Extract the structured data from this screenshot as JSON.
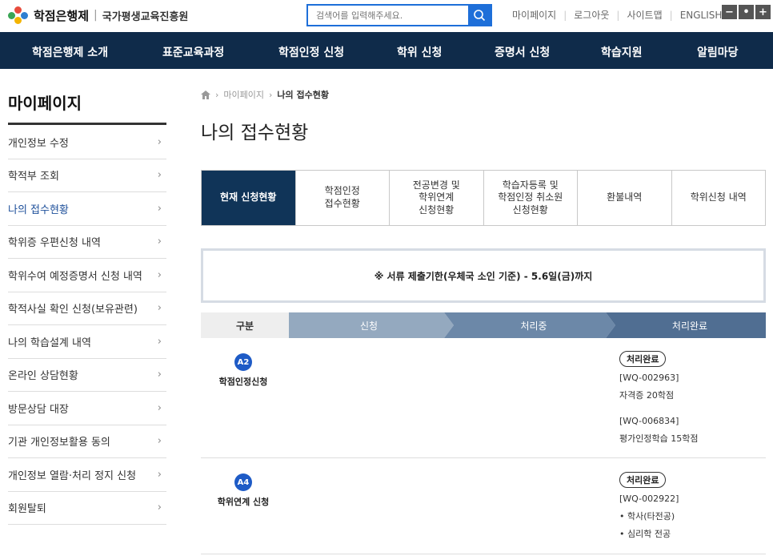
{
  "header": {
    "logo_title": "학점은행제",
    "logo_sub": "국가평생교육진흥원",
    "search_placeholder": "검색어를 입력해주세요.",
    "util_links": [
      "마이페이지",
      "로그아웃",
      "사이트맵",
      "ENGLISH"
    ],
    "zoom": [
      "−",
      "•",
      "+"
    ]
  },
  "gnb": [
    "학점은행제 소개",
    "표준교육과정",
    "학점인정 신청",
    "학위 신청",
    "증명서 신청",
    "학습지원",
    "알림마당"
  ],
  "sidebar": {
    "title": "마이페이지",
    "items": [
      {
        "label": "개인정보 수정"
      },
      {
        "label": "학적부 조회"
      },
      {
        "label": "나의 접수현황"
      },
      {
        "label": "학위증 우편신청 내역"
      },
      {
        "label": "학위수여 예정증명서 신청 내역"
      },
      {
        "label": "학적사실 확인 신청(보유관련)"
      },
      {
        "label": "나의 학습설계 내역"
      },
      {
        "label": "온라인 상담현황"
      },
      {
        "label": "방문상담 대장"
      },
      {
        "label": "기관 개인정보활용 동의"
      },
      {
        "label": "개인정보 열람·처리 정지 신청"
      },
      {
        "label": "회원탈퇴"
      }
    ]
  },
  "breadcrumb": [
    "마이페이지",
    "나의 접수현황"
  ],
  "page_title": "나의 접수현황",
  "tabs": [
    "현재 신청현황",
    "학점인정\n접수현황",
    "전공변경 및\n학위연계\n신청현황",
    "학습자등록 및\n학점인정 취소원\n신청현황",
    "환불내역",
    "학위신청 내역"
  ],
  "notice": "※ 서류 제출기한(우체국 소인 기준) - 5.6일(금)까지",
  "steps": {
    "gubun": "구분",
    "items": [
      "신청",
      "처리중",
      "처리완료"
    ]
  },
  "rows": [
    {
      "badge": "A2",
      "label": "학점인정신청",
      "status": "처리완료",
      "lines_a": [
        "[WQ-002963]",
        "자격증 20학점"
      ],
      "lines_b": [
        "[WQ-006834]",
        "평가인정학습 15학점"
      ]
    },
    {
      "badge": "A4",
      "label": "학위연계 신청",
      "status": "처리완료",
      "lines_a": [
        "[WQ-002922]",
        "•  학사(타전공)",
        "•  심리학 전공"
      ]
    }
  ]
}
